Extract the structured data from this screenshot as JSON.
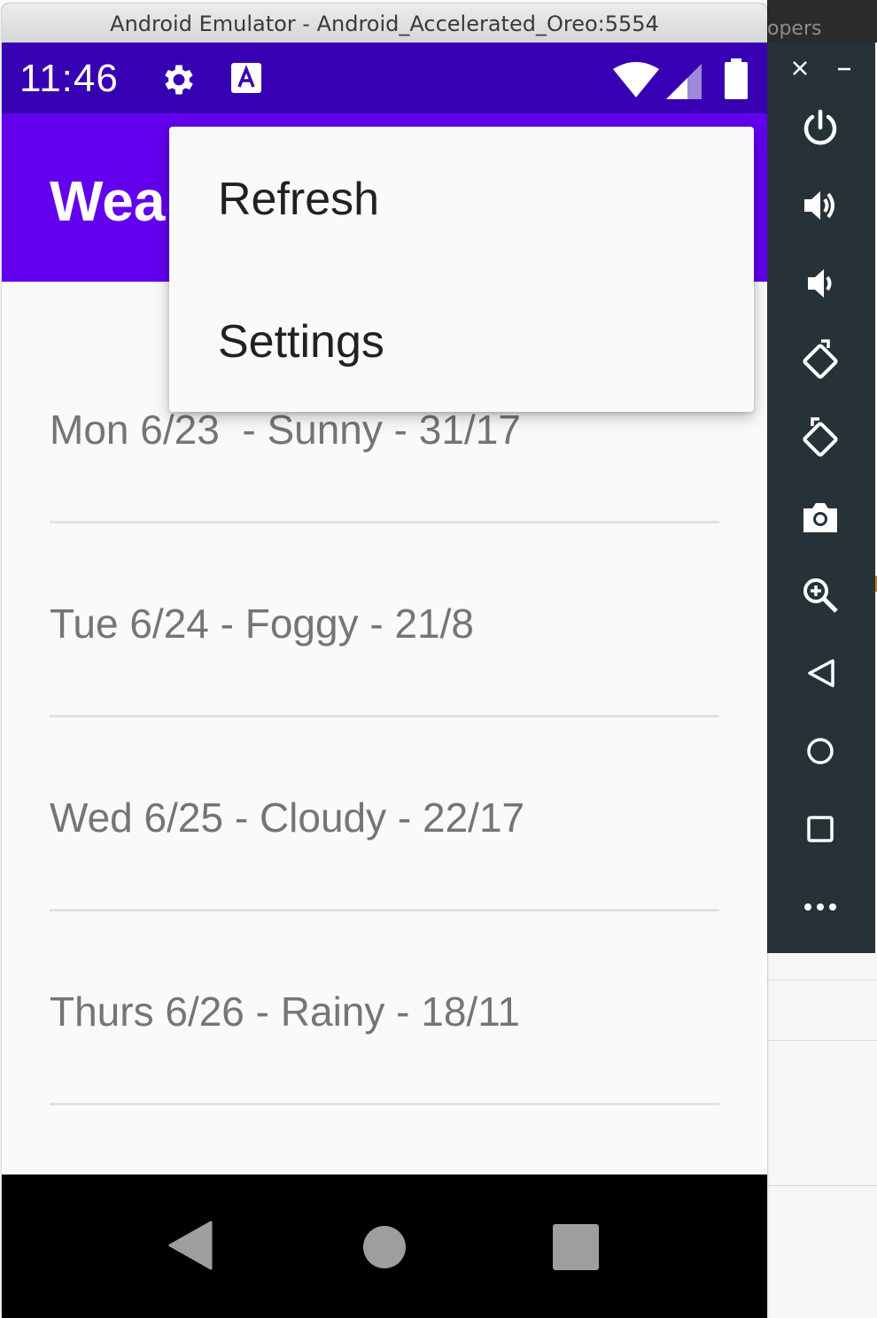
{
  "host": {
    "peek_text": "opers"
  },
  "window": {
    "title": "Android Emulator - Android_Accelerated_Oreo:5554"
  },
  "status_bar": {
    "time": "11:46"
  },
  "app_bar": {
    "title": "Wea"
  },
  "forecast": {
    "items": [
      {
        "text": "Mon 6/23  - Sunny - 31/17"
      },
      {
        "text": "Tue 6/24 - Foggy - 21/8"
      },
      {
        "text": "Wed 6/25 - Cloudy - 22/17"
      },
      {
        "text": "Thurs 6/26 - Rainy - 18/11"
      }
    ]
  },
  "overflow_menu": {
    "items": [
      {
        "label": "Refresh"
      },
      {
        "label": "Settings"
      }
    ]
  },
  "colors": {
    "status_bar": "#3700b3",
    "app_bar": "#6200ee",
    "toolbar": "#263238",
    "list_text": "#757575"
  },
  "toolbar_icons": [
    "close-icon",
    "minimize-icon",
    "power-icon",
    "volume-up-icon",
    "volume-down-icon",
    "rotate-left-icon",
    "rotate-right-icon",
    "camera-icon",
    "zoom-icon",
    "back-icon",
    "home-icon",
    "overview-icon",
    "more-icon"
  ]
}
